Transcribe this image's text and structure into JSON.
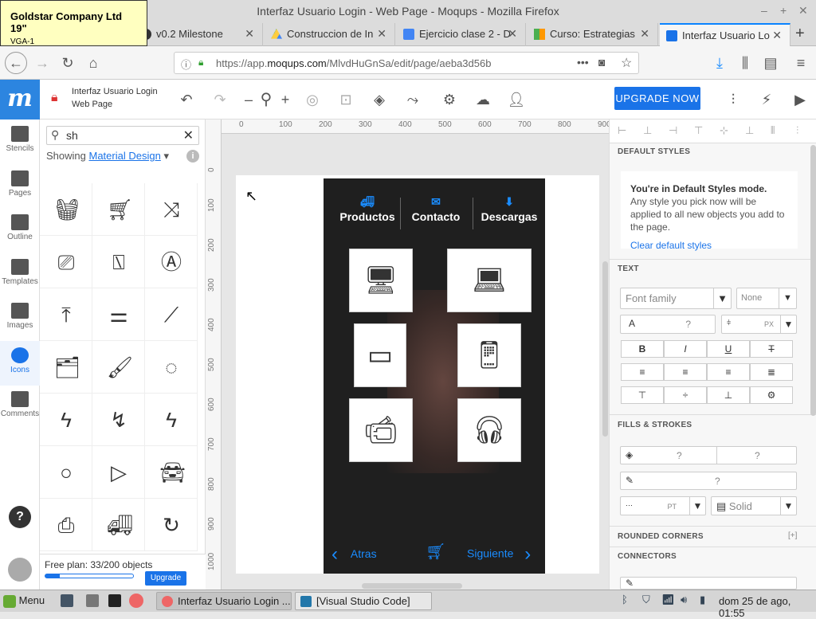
{
  "tooltip": {
    "title": "Goldstar Company Ltd 19\"",
    "subtitle": "VGA-1"
  },
  "window": {
    "title": "Interfaz Usuario Login - Web Page - Moqups - Mozilla Firefox"
  },
  "tabs": [
    {
      "label": "v0.2 Milestone",
      "icon": "github-icon"
    },
    {
      "label": "Construccion de In",
      "icon": "drive-icon"
    },
    {
      "label": "Ejercicio clase 2 - D",
      "icon": "docs-icon"
    },
    {
      "label": "Curso: Estrategias",
      "icon": "course-icon"
    },
    {
      "label": "Interfaz Usuario Lo",
      "icon": "moqups-icon"
    }
  ],
  "url": {
    "prefix": "https://app.",
    "domain": "moqups.com",
    "path": "/MlvdHuGnSa/edit/page/aeba3d56b"
  },
  "doc": {
    "name_line1": "Interfaz Usuario Login",
    "name_line2": "Web Page"
  },
  "upgrade_label": "UPGRADE NOW",
  "rail": [
    {
      "label": "Stencils",
      "icon": "stencils-icon"
    },
    {
      "label": "Pages",
      "icon": "pages-icon"
    },
    {
      "label": "Outline",
      "icon": "outline-icon"
    },
    {
      "label": "Templates",
      "icon": "templates-icon"
    },
    {
      "label": "Images",
      "icon": "images-icon"
    },
    {
      "label": "Icons",
      "icon": "icons-icon"
    },
    {
      "label": "Comments",
      "icon": "comments-icon"
    }
  ],
  "panel": {
    "search_value": "sh",
    "showing_label": "Showing",
    "library": "Material Design",
    "free_plan": "Free plan: 33/200 objects",
    "free_plan_fraction": 0.165,
    "upgrade": "Upgrade"
  },
  "ruler": {
    "h": [
      "0",
      "100",
      "200",
      "300",
      "400",
      "500",
      "600",
      "700",
      "800",
      "900"
    ],
    "v": [
      "0",
      "100",
      "200",
      "300",
      "400",
      "500",
      "600",
      "700",
      "800",
      "900",
      "1000"
    ]
  },
  "mockup": {
    "nav": [
      "Productos",
      "Contacto",
      "Descargas"
    ],
    "back": "Atras",
    "next": "Siguiente"
  },
  "right": {
    "default_styles": "DEFAULT STYLES",
    "mode_title": "You're in Default Styles mode.",
    "mode_text": "Any style you pick now will be applied to all new objects you add to the page.",
    "clear": "Clear default styles",
    "text_section": "TEXT",
    "font_family": "Font family",
    "font_none": "None",
    "font_size": "?",
    "line_height_unit": "PX",
    "fills": "FILLS & STROKES",
    "fill_q": "?",
    "stroke_unit": "PT",
    "stroke_style": "Solid",
    "rounded": "ROUNDED CORNERS",
    "rounded_add": "[+]",
    "connectors": "CONNECTORS"
  },
  "taskbar": {
    "menu": "Menu",
    "tasks": [
      "Interfaz Usuario Login ...",
      "[Visual Studio Code]"
    ],
    "clock": "dom 25 de ago, 01:55"
  }
}
